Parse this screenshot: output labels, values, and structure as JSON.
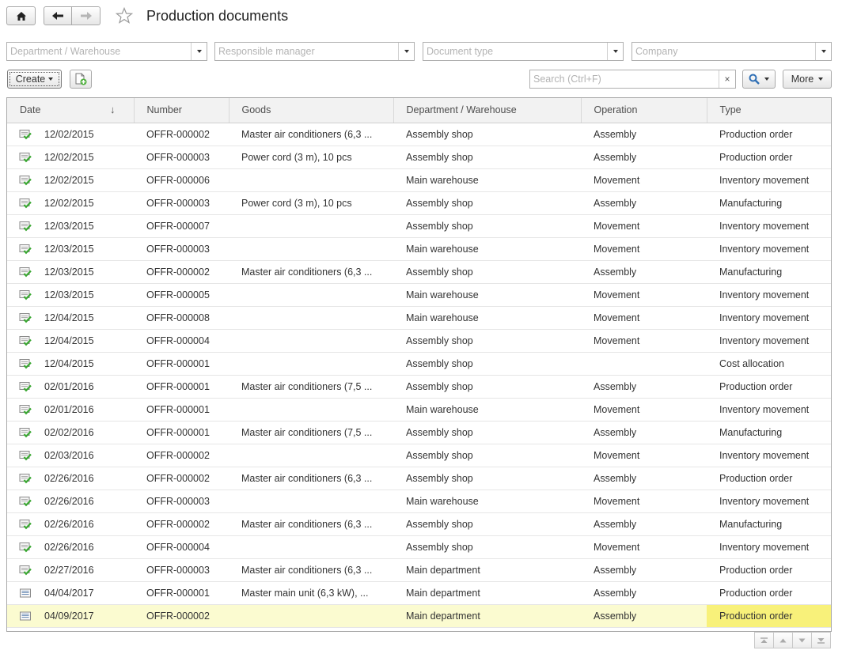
{
  "header": {
    "title": "Production documents",
    "home_icon": "home-icon",
    "back_icon": "arrow-left-icon",
    "forward_icon": "arrow-right-icon",
    "favorite_icon": "star-icon"
  },
  "filters": {
    "department_placeholder": "Department / Warehouse",
    "manager_placeholder": "Responsible manager",
    "doctype_placeholder": "Document type",
    "company_placeholder": "Company"
  },
  "toolbar": {
    "create_label": "Create",
    "search_placeholder": "Search (Ctrl+F)",
    "clear_symbol": "×",
    "more_label": "More"
  },
  "table": {
    "columns": {
      "date": "Date",
      "number": "Number",
      "goods": "Goods",
      "department": "Department / Warehouse",
      "operation": "Operation",
      "type": "Type"
    },
    "sort_arrow": "↓",
    "rows": [
      {
        "status": "posted",
        "date": "12/02/2015",
        "number": "OFFR-000002",
        "goods": "Master air conditioners (6,3 ...",
        "department": "Assembly shop",
        "operation": "Assembly",
        "type": "Production order"
      },
      {
        "status": "posted",
        "date": "12/02/2015",
        "number": "OFFR-000003",
        "goods": "Power cord (3 m), 10 pcs",
        "department": "Assembly shop",
        "operation": "Assembly",
        "type": "Production order"
      },
      {
        "status": "posted",
        "date": "12/02/2015",
        "number": "OFFR-000006",
        "goods": "",
        "department": "Main warehouse",
        "operation": "Movement",
        "type": "Inventory movement"
      },
      {
        "status": "posted",
        "date": "12/02/2015",
        "number": "OFFR-000003",
        "goods": "Power cord (3 m), 10 pcs",
        "department": "Assembly shop",
        "operation": "Assembly",
        "type": "Manufacturing"
      },
      {
        "status": "posted",
        "date": "12/03/2015",
        "number": "OFFR-000007",
        "goods": "",
        "department": "Assembly shop",
        "operation": "Movement",
        "type": "Inventory movement"
      },
      {
        "status": "posted",
        "date": "12/03/2015",
        "number": "OFFR-000003",
        "goods": "",
        "department": "Main warehouse",
        "operation": "Movement",
        "type": "Inventory movement"
      },
      {
        "status": "posted",
        "date": "12/03/2015",
        "number": "OFFR-000002",
        "goods": "Master air conditioners (6,3 ...",
        "department": "Assembly shop",
        "operation": "Assembly",
        "type": "Manufacturing"
      },
      {
        "status": "posted",
        "date": "12/03/2015",
        "number": "OFFR-000005",
        "goods": "",
        "department": "Main warehouse",
        "operation": "Movement",
        "type": "Inventory movement"
      },
      {
        "status": "posted",
        "date": "12/04/2015",
        "number": "OFFR-000008",
        "goods": "",
        "department": "Main warehouse",
        "operation": "Movement",
        "type": "Inventory movement"
      },
      {
        "status": "posted",
        "date": "12/04/2015",
        "number": "OFFR-000004",
        "goods": "",
        "department": "Assembly shop",
        "operation": "Movement",
        "type": "Inventory movement"
      },
      {
        "status": "posted",
        "date": "12/04/2015",
        "number": "OFFR-000001",
        "goods": "",
        "department": "Assembly shop",
        "operation": "",
        "type": "Cost allocation"
      },
      {
        "status": "posted",
        "date": "02/01/2016",
        "number": "OFFR-000001",
        "goods": "Master air conditioners (7,5 ...",
        "department": "Assembly shop",
        "operation": "Assembly",
        "type": "Production order"
      },
      {
        "status": "posted",
        "date": "02/01/2016",
        "number": "OFFR-000001",
        "goods": "",
        "department": "Main warehouse",
        "operation": "Movement",
        "type": "Inventory movement"
      },
      {
        "status": "posted",
        "date": "02/02/2016",
        "number": "OFFR-000001",
        "goods": "Master air conditioners (7,5 ...",
        "department": "Assembly shop",
        "operation": "Assembly",
        "type": "Manufacturing"
      },
      {
        "status": "posted",
        "date": "02/03/2016",
        "number": "OFFR-000002",
        "goods": "",
        "department": "Assembly shop",
        "operation": "Movement",
        "type": "Inventory movement"
      },
      {
        "status": "posted",
        "date": "02/26/2016",
        "number": "OFFR-000002",
        "goods": "Master air conditioners (6,3 ...",
        "department": "Assembly shop",
        "operation": "Assembly",
        "type": "Production order"
      },
      {
        "status": "posted",
        "date": "02/26/2016",
        "number": "OFFR-000003",
        "goods": "",
        "department": "Main warehouse",
        "operation": "Movement",
        "type": "Inventory movement"
      },
      {
        "status": "posted",
        "date": "02/26/2016",
        "number": "OFFR-000002",
        "goods": "Master air conditioners (6,3 ...",
        "department": "Assembly shop",
        "operation": "Assembly",
        "type": "Manufacturing"
      },
      {
        "status": "posted",
        "date": "02/26/2016",
        "number": "OFFR-000004",
        "goods": "",
        "department": "Assembly shop",
        "operation": "Movement",
        "type": "Inventory movement"
      },
      {
        "status": "posted",
        "date": "02/27/2016",
        "number": "OFFR-000003",
        "goods": "Master air conditioners (6,3 ...",
        "department": "Main department",
        "operation": "Assembly",
        "type": "Production order"
      },
      {
        "status": "draft",
        "date": "04/04/2017",
        "number": "OFFR-000001",
        "goods": "Master main unit (6,3 kW), ...",
        "department": "Main department",
        "operation": "Assembly",
        "type": "Production order"
      },
      {
        "status": "draft",
        "date": "04/09/2017",
        "number": "OFFR-000002",
        "goods": "",
        "department": "Main department",
        "operation": "Assembly",
        "type": "Production order",
        "selected": true
      }
    ]
  },
  "colors": {
    "accent": "#3a7fc4",
    "posted_check": "#3aa832",
    "selected_row": "#fbfbd0",
    "selected_cell": "#f8f17a"
  }
}
